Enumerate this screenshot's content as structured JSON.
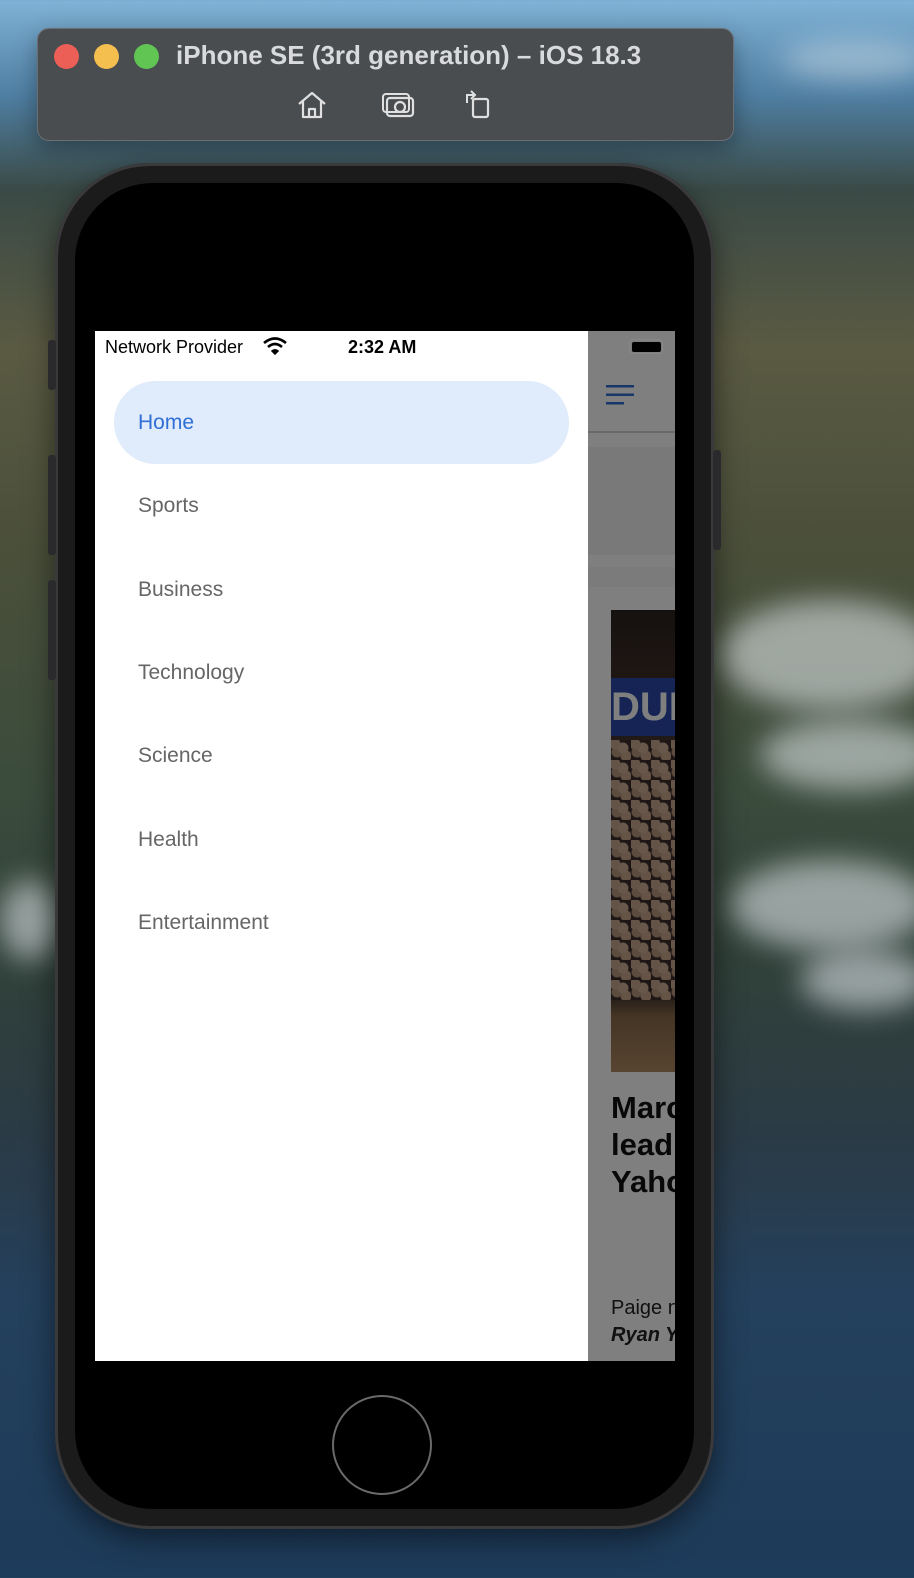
{
  "simulator": {
    "title": "iPhone SE (3rd generation) – iOS 18.3",
    "buttons": [
      "home-icon",
      "screenshot-icon",
      "rotate-icon"
    ]
  },
  "status_bar": {
    "carrier": "Network Provider",
    "time": "2:32 AM"
  },
  "drawer": {
    "active_index": 0,
    "active_color": "#2f6fd6",
    "active_bg": "#e0ebfb",
    "items": [
      {
        "label": "Home"
      },
      {
        "label": "Sports"
      },
      {
        "label": "Business"
      },
      {
        "label": "Technology"
      },
      {
        "label": "Science"
      },
      {
        "label": "Health"
      },
      {
        "label": "Entertainment"
      }
    ]
  },
  "app": {
    "header_icon": "menu-icon",
    "article": {
      "image_banner": "DUK",
      "headline": "Marc Bued lead dom Yaho",
      "snippet_text": "Paige nation",
      "snippet_author": "Ryan Y"
    }
  }
}
